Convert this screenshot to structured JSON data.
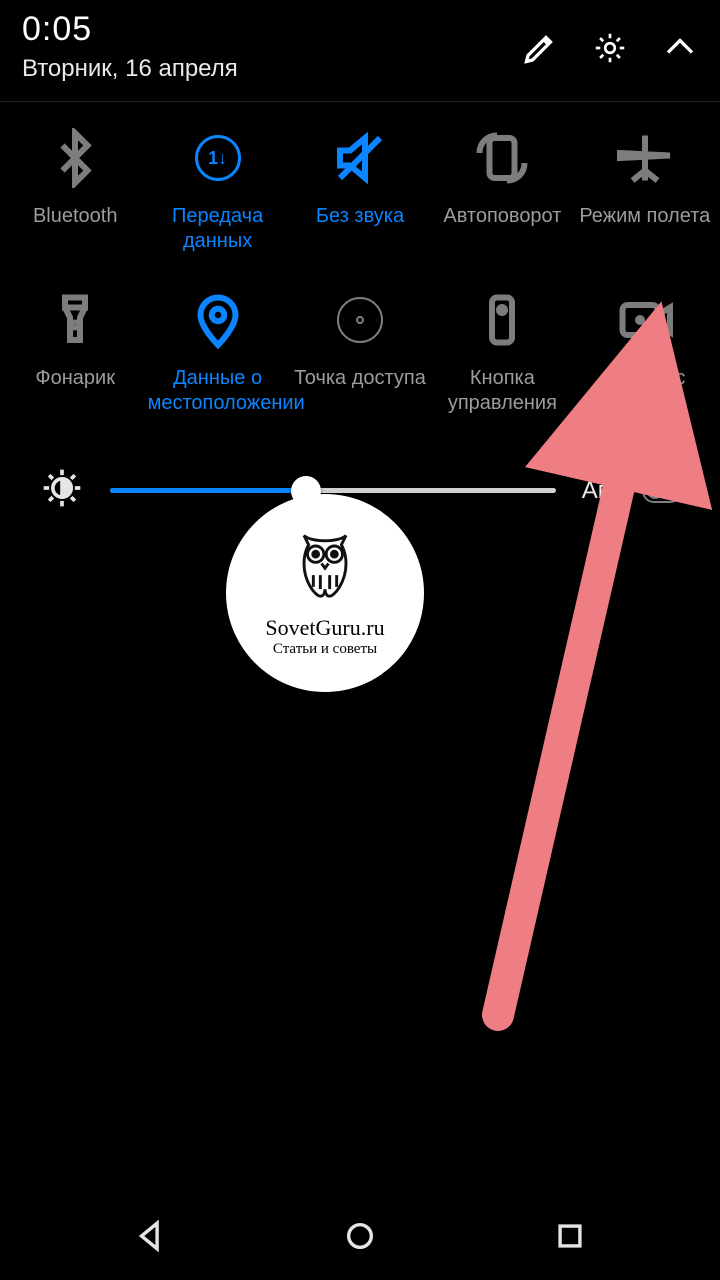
{
  "status": {
    "time": "0:05",
    "date": "Вторник, 16 апреля"
  },
  "header_icons": {
    "edit": "edit-icon",
    "settings": "gear-icon",
    "collapse": "chevron-up-icon"
  },
  "tiles": [
    {
      "key": "bluetooth",
      "label": "Bluetooth",
      "icon": "bluetooth-icon",
      "active": false
    },
    {
      "key": "mobiledata",
      "label": "Передача данных",
      "icon": "data-transfer-icon",
      "active": true
    },
    {
      "key": "silent",
      "label": "Без звука",
      "icon": "sound-off-icon",
      "active": true
    },
    {
      "key": "autorotate",
      "label": "Автоповорот",
      "icon": "auto-rotate-icon",
      "active": false
    },
    {
      "key": "airplane",
      "label": "Режим полета",
      "icon": "airplane-icon",
      "active": false
    },
    {
      "key": "flashlight",
      "label": "Фонарик",
      "icon": "flashlight-icon",
      "active": false
    },
    {
      "key": "location",
      "label": "Данные о местоположении",
      "icon": "location-icon",
      "active": true
    },
    {
      "key": "hotspot",
      "label": "Точка доступа",
      "icon": "hotspot-icon",
      "active": false
    },
    {
      "key": "remote",
      "label": "Кнопка управления",
      "icon": "remote-icon",
      "active": false
    },
    {
      "key": "screenrec",
      "label": "Запись с экрана",
      "icon": "screen-record-icon",
      "active": false
    }
  ],
  "brightness": {
    "value_pct": 44,
    "auto_label": "Авто",
    "auto_on": false
  },
  "watermark": {
    "line1": "SovetGuru.ru",
    "line2": "Статьи и советы"
  },
  "annotation": {
    "arrow_target": "screenrec",
    "color": "#ee7e83"
  },
  "nav": {
    "back": "back-icon",
    "home": "home-icon",
    "recent": "recent-icon"
  }
}
